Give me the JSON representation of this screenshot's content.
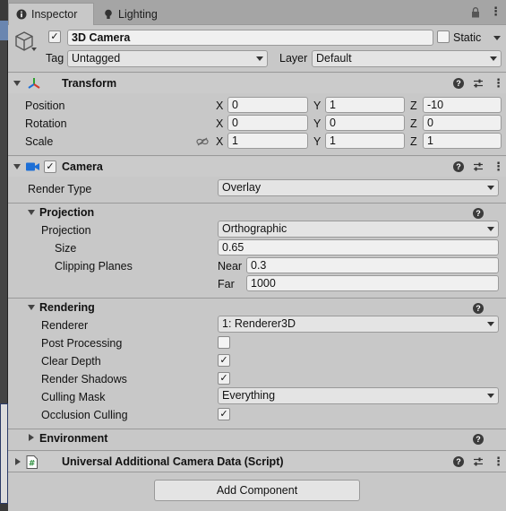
{
  "tabs": [
    {
      "label": "Inspector"
    },
    {
      "label": "Lighting"
    }
  ],
  "object": {
    "active": true,
    "name": "3D Camera",
    "static_label": "Static",
    "static": false,
    "tag_label": "Tag",
    "tag_value": "Untagged",
    "layer_label": "Layer",
    "layer_value": "Default"
  },
  "transform": {
    "title": "Transform",
    "rows": [
      {
        "label": "Position",
        "x": "0",
        "y": "1",
        "z": "-10"
      },
      {
        "label": "Rotation",
        "x": "0",
        "y": "0",
        "z": "0"
      },
      {
        "label": "Scale",
        "x": "1",
        "y": "1",
        "z": "1"
      }
    ],
    "axis": {
      "x": "X",
      "y": "Y",
      "z": "Z"
    }
  },
  "camera": {
    "title": "Camera",
    "enabled": true,
    "render_type_label": "Render Type",
    "render_type_value": "Overlay",
    "projection_section": "Projection",
    "projection_label": "Projection",
    "projection_value": "Orthographic",
    "size_label": "Size",
    "size_value": "0.65",
    "clipping_label": "Clipping Planes",
    "near_label": "Near",
    "near_value": "0.3",
    "far_label": "Far",
    "far_value": "1000",
    "rendering_section": "Rendering",
    "renderer_label": "Renderer",
    "renderer_value": "1: Renderer3D",
    "post_processing_label": "Post Processing",
    "post_processing": false,
    "clear_depth_label": "Clear Depth",
    "clear_depth": true,
    "render_shadows_label": "Render Shadows",
    "render_shadows": true,
    "culling_mask_label": "Culling Mask",
    "culling_mask_value": "Everything",
    "occlusion_culling_label": "Occlusion Culling",
    "occlusion_culling": true,
    "environment_section": "Environment"
  },
  "script_component": {
    "title": "Universal Additional Camera Data (Script)"
  },
  "add_component_label": "Add Component",
  "colors": {
    "panel_bg": "#c8c8c8",
    "camera_icon": "#1d6fd6",
    "script_icon": "#2f8f3f"
  }
}
